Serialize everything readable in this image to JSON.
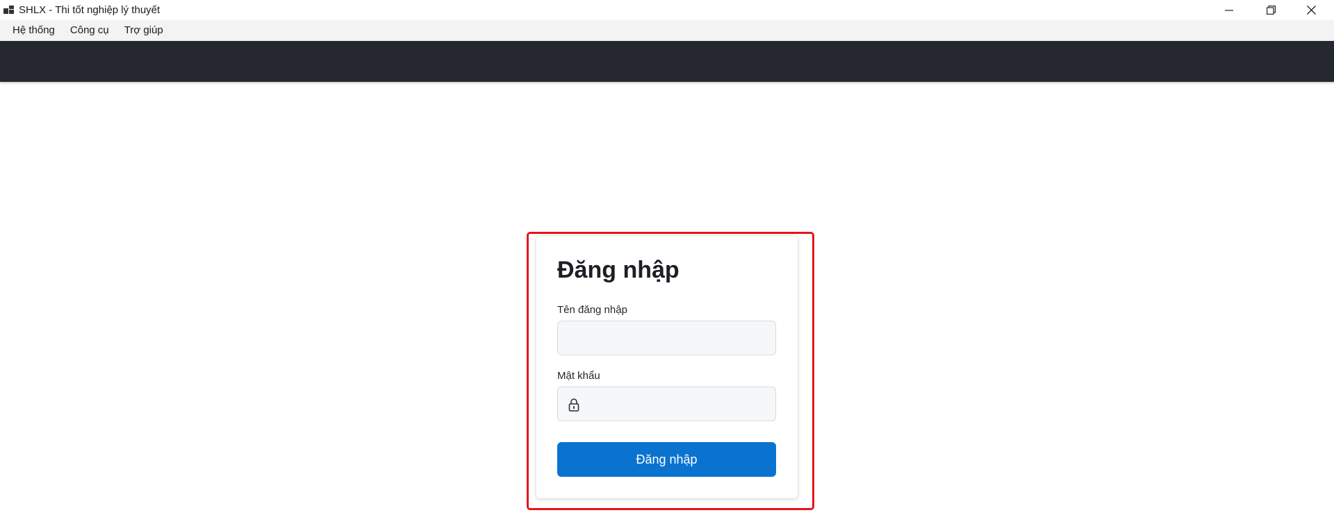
{
  "window": {
    "title": "SHLX - Thi tốt nghiệp lý thuyết",
    "icons": [
      "app-icon",
      "minimize-icon",
      "restore-icon",
      "close-icon"
    ]
  },
  "menu": {
    "items": [
      "Hệ thống",
      "Công cụ",
      "Trợ giúp"
    ]
  },
  "login": {
    "title": "Đăng nhập",
    "username_label": "Tên đăng nhập",
    "username_value": "",
    "password_label": "Mật khẩu",
    "password_value": "",
    "submit_label": "Đăng nhập",
    "lock_icon": "lock-icon"
  },
  "colors": {
    "header_band": "#252830",
    "primary_button": "#0a73d0",
    "highlight_border": "#e8141c"
  }
}
